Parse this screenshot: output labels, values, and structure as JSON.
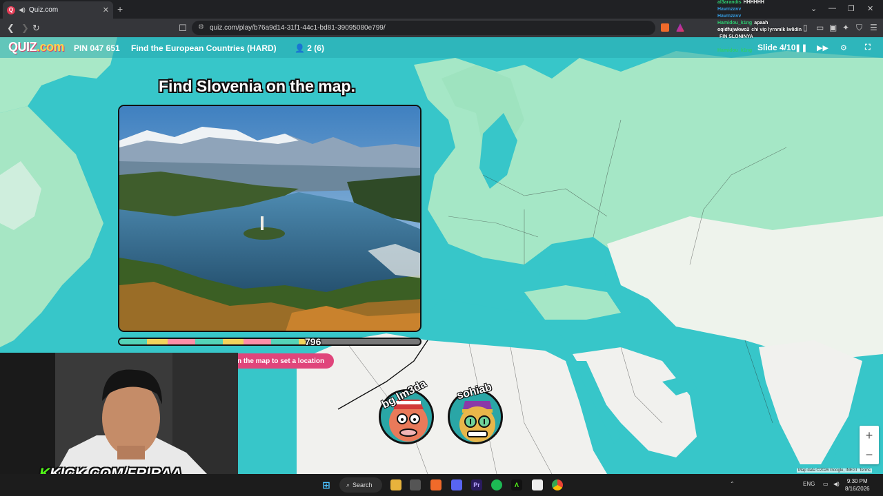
{
  "browser": {
    "tab_title": "Quiz.com",
    "url": "quiz.com/play/b76a9d14-31f1-44c1-bd81-39095080e799/"
  },
  "quiz": {
    "logo": "QUIZ",
    "logo_suffix": ".com",
    "pin": "PIN 047 651",
    "game_name": "Find the European Countries (HARD)",
    "players": "2 (6)",
    "slide": "Slide 4/10",
    "question": "Find Slovenia on the map.",
    "timer_value": "796",
    "timer_fraction": 0.62,
    "hint": "n the map to set a location"
  },
  "player_list": [
    {
      "name": "bg lm3da"
    },
    {
      "name": "sohiab"
    }
  ],
  "stream": {
    "kick_brand": "K",
    "kick_url": "KICK.COM/FRIRAA"
  },
  "chat": [
    {
      "user": "al3arandis",
      "msg": "HHHHHH",
      "color": "#2ecc71"
    },
    {
      "user": "Havmzavv",
      "msg": "",
      "color": "#3498db"
    },
    {
      "user": "Havmzavv",
      "msg": "",
      "color": "#3498db"
    },
    {
      "user": "Hamidou_k1ng",
      "msg": "apaah",
      "color": "#2ecc71"
    },
    {
      "user": "oqidfujwkwo2",
      "msg": "chi vip lyrnmlk lwlidin",
      "color": "#ffffff"
    },
    {
      "user": "",
      "msg": "FIN SLONINYA",
      "color": "#ff5252"
    },
    {
      "user": "Hamidou_k1ng",
      "msg": "",
      "color": "#2ecc71"
    }
  ],
  "map": {
    "attribution": "Map data ©2026 Google, INEGI",
    "terms": "Terms",
    "zoom_in": "+",
    "zoom_out": "−"
  },
  "taskbar": {
    "search": "Search",
    "lang": "ENG",
    "time": "9:30 PM",
    "date": "8/16/2026"
  }
}
